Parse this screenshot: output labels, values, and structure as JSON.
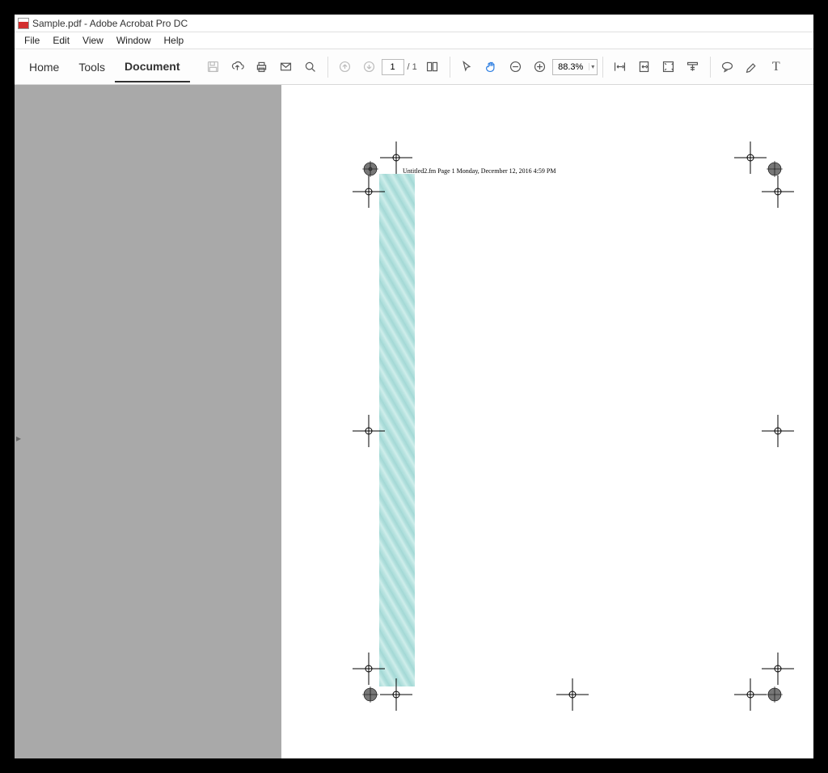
{
  "window_title": "Sample.pdf - Adobe Acrobat Pro DC",
  "menu": {
    "file": "File",
    "edit": "Edit",
    "view": "View",
    "window": "Window",
    "help": "Help"
  },
  "tabs": {
    "home": "Home",
    "tools": "Tools",
    "document": "Document"
  },
  "page_input": "1",
  "total_pages": "/  1",
  "zoom": "88.3%",
  "doc_header": "Untitled2.fm  Page 1  Monday, December 12, 2016  4:59 PM"
}
